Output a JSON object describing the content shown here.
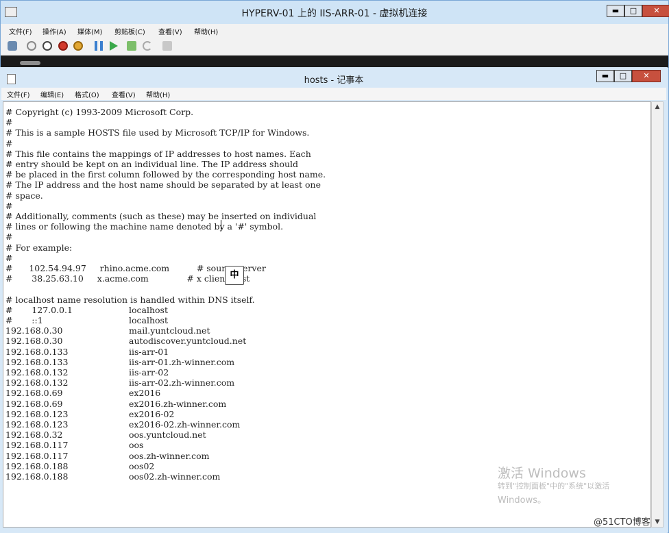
{
  "vm_window": {
    "title": "HYPERV-01 上的 IIS-ARR-01 - 虚拟机连接",
    "buttons": {
      "minimize": "▬",
      "maximize": "□",
      "close": "✕"
    },
    "menu": [
      "文件(F)",
      "操作(A)",
      "媒体(M)",
      "剪贴板(C)",
      "查看(V)",
      "帮助(H)"
    ],
    "toolbar_icons": [
      "ctrl-alt-del-icon",
      "start-icon",
      "turn-off-icon",
      "shutdown-icon",
      "save-icon",
      "pause-icon",
      "reset-icon",
      "checkpoint-icon",
      "revert-icon",
      "enhanced-session-icon"
    ]
  },
  "notepad": {
    "title": "hosts - 记事本",
    "buttons": {
      "minimize": "▬",
      "maximize": "□",
      "close": "✕"
    },
    "menu": [
      "文件(F)",
      "编辑(E)",
      "格式(O)",
      "查看(V)",
      "帮助(H)"
    ],
    "header_lines": [
      "# Copyright (c) 1993-2009 Microsoft Corp.",
      "#",
      "# This is a sample HOSTS file used by Microsoft TCP/IP for Windows.",
      "#",
      "# This file contains the mappings of IP addresses to host names. Each",
      "# entry should be kept on an individual line. The IP address should",
      "# be placed in the first column followed by the corresponding host name.",
      "# The IP address and the host name should be separated by at least one",
      "# space.",
      "#",
      "# Additionally, comments (such as these) may be inserted on individual",
      "# lines or following the machine name denoted by a '#' symbol.",
      "#",
      "# For example:",
      "#",
      "#      102.54.94.97     rhino.acme.com          # source server",
      "#       38.25.63.10     x.acme.com              # x client host",
      "",
      "# localhost name resolution is handled within DNS itself."
    ],
    "entries": [
      {
        "ip": "#       127.0.0.1",
        "host": "localhost"
      },
      {
        "ip": "#       ::1",
        "host": "localhost"
      },
      {
        "ip": "192.168.0.30",
        "host": "mail.yuntcloud.net"
      },
      {
        "ip": "192.168.0.30",
        "host": "autodiscover.yuntcloud.net"
      },
      {
        "ip": "192.168.0.133",
        "host": "iis-arr-01"
      },
      {
        "ip": "192.168.0.133",
        "host": "iis-arr-01.zh-winner.com"
      },
      {
        "ip": "192.168.0.132",
        "host": "iis-arr-02"
      },
      {
        "ip": "192.168.0.132",
        "host": "iis-arr-02.zh-winner.com"
      },
      {
        "ip": "192.168.0.69",
        "host": "ex2016"
      },
      {
        "ip": "192.168.0.69",
        "host": "ex2016.zh-winner.com"
      },
      {
        "ip": "192.168.0.123",
        "host": "ex2016-02"
      },
      {
        "ip": "192.168.0.123",
        "host": "ex2016-02.zh-winner.com"
      },
      {
        "ip": "192.168.0.32",
        "host": "oos.yuntcloud.net"
      },
      {
        "ip": "192.168.0.117",
        "host": "oos"
      },
      {
        "ip": "192.168.0.117",
        "host": "oos.zh-winner.com"
      },
      {
        "ip": "192.168.0.188",
        "host": "oos02"
      },
      {
        "ip": "192.168.0.188",
        "host": "oos02.zh-winner.com"
      }
    ]
  },
  "ime_indicator": "中",
  "watermark": {
    "line1": "激活 Windows",
    "line2": "转到\"控制面板\"中的\"系统\"以激活",
    "line3": "Windows。"
  },
  "credit": "@51CTO博客"
}
